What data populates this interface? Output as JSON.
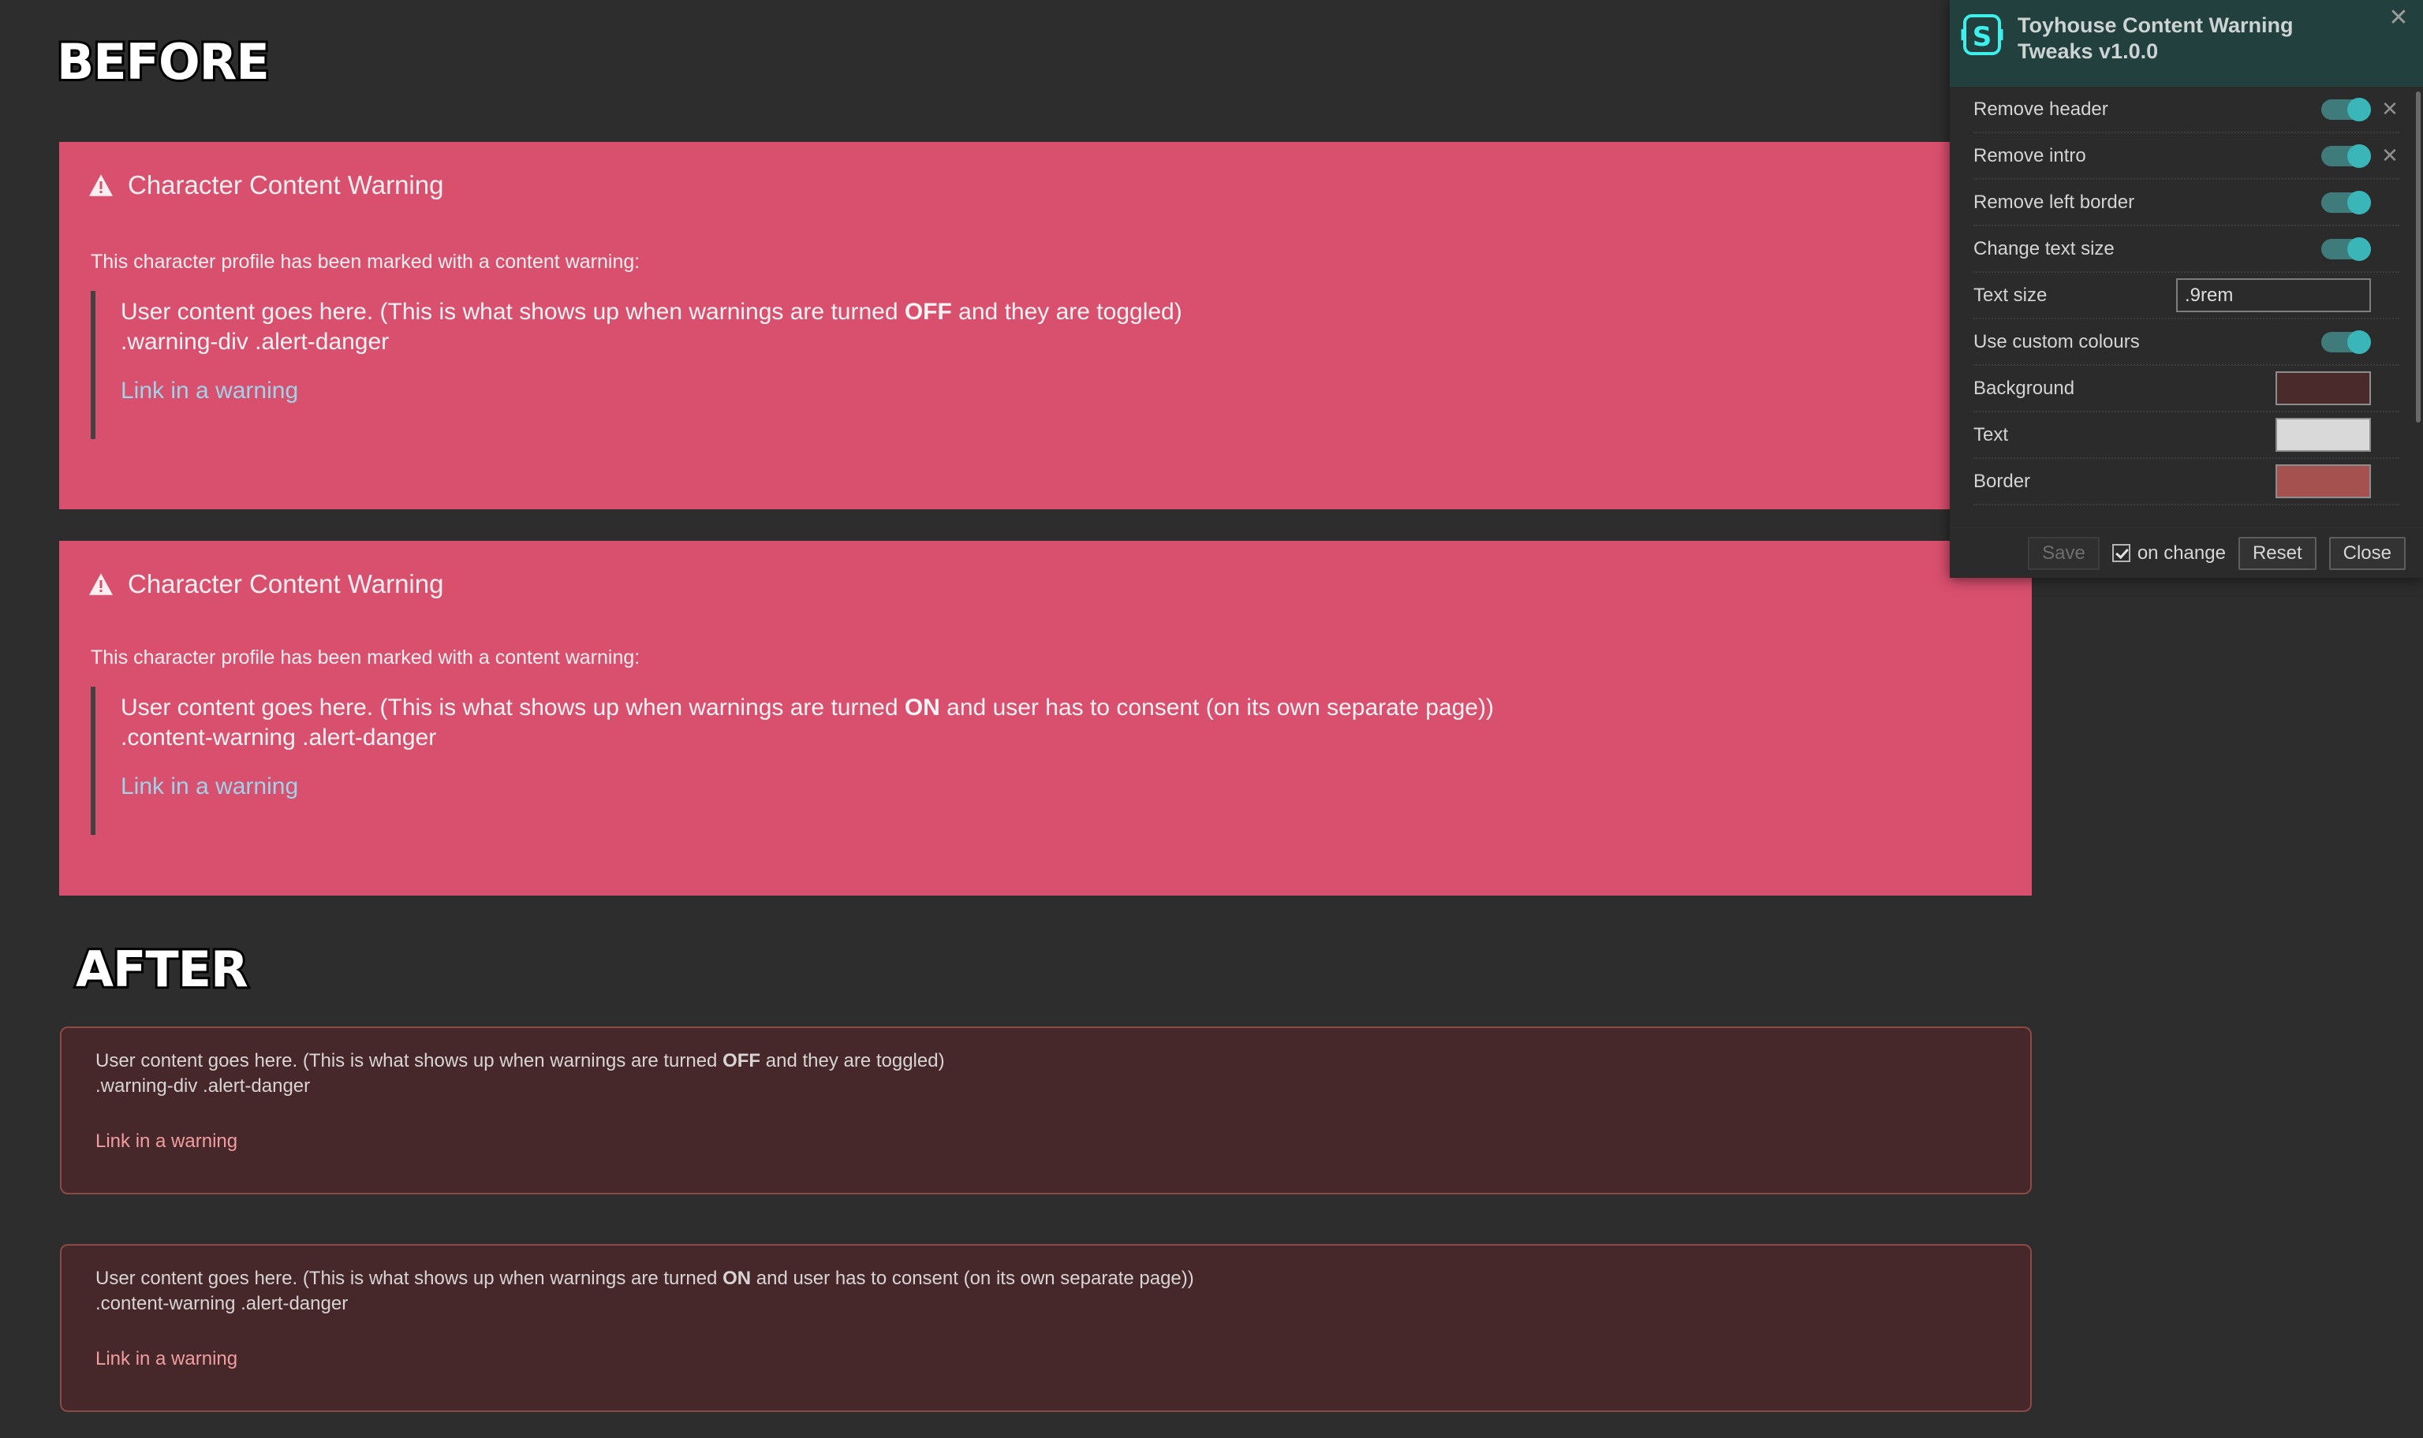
{
  "sections": {
    "before_heading": "BEFORE",
    "after_heading": "AFTER"
  },
  "before_cards": [
    {
      "header": "Character Content Warning",
      "intro": "This character profile has been marked with a content warning:",
      "quote_text_1": "User content goes here. (This is what shows up when warnings are turned ",
      "quote_emphasis": "OFF",
      "quote_text_2": " and they are toggled)",
      "selector": ".warning-div .alert-danger",
      "link": "Link in a warning"
    },
    {
      "header": "Character Content Warning",
      "intro": "This character profile has been marked with a content warning:",
      "quote_text_1": "User content goes here. (This is what shows up when warnings are turned ",
      "quote_emphasis": "ON",
      "quote_text_2": " and user has to consent (on its own separate page))",
      "selector": ".content-warning .alert-danger",
      "link": "Link in a warning"
    }
  ],
  "after_cards": [
    {
      "text_1": "User content goes here. (This is what shows up when warnings are turned ",
      "emphasis": "OFF",
      "text_2": " and they are toggled)",
      "selector": ".warning-div .alert-danger",
      "link": "Link in a warning"
    },
    {
      "text_1": "User content goes here. (This is what shows up when warnings are turned ",
      "emphasis": "ON",
      "text_2": " and user has to consent (on its own separate page))",
      "selector": ".content-warning .alert-danger",
      "link": "Link in a warning"
    }
  ],
  "panel": {
    "title": "Toyhouse Content Warning Tweaks v1.0.0",
    "logo_icon": "stylus-s-logo-icon",
    "close_icon": "✕",
    "row_remove_icon": "✕",
    "options": [
      {
        "label": "Remove header",
        "control": "toggle",
        "state": "on",
        "has_remove": true
      },
      {
        "label": "Remove intro",
        "control": "toggle",
        "state": "on",
        "has_remove": true
      },
      {
        "label": "Remove left border",
        "control": "toggle",
        "state": "on",
        "has_remove": false
      },
      {
        "label": "Change text size",
        "control": "toggle",
        "state": "on",
        "has_remove": false
      },
      {
        "label": "Text size",
        "control": "text",
        "value": ".9rem",
        "has_remove": false
      },
      {
        "label": "Use custom colours",
        "control": "toggle",
        "state": "on",
        "has_remove": false
      },
      {
        "label": "Background",
        "control": "color",
        "value": "#4b2a2b",
        "has_remove": false
      },
      {
        "label": "Text",
        "control": "color",
        "value": "#d9d9d9",
        "has_remove": false
      },
      {
        "label": "Border",
        "control": "color",
        "value": "#a4514f",
        "has_remove": false
      }
    ],
    "footer": {
      "save_label": "Save",
      "on_change_label": "on change",
      "on_change_checked": true,
      "reset_label": "Reset",
      "close_label": "Close"
    }
  },
  "colors": {
    "page_bg": "#2d2d2d",
    "before_card_bg": "#d94f6e",
    "before_link": "#9fd3ea",
    "after_card_bg": "#47282a",
    "after_card_border": "#8b4a45",
    "after_link": "#f09da0",
    "panel_header_bg": "#21403e",
    "panel_bg": "#2b2b2b",
    "toggle_on": "#3ab5b8",
    "logo_accent": "#3ef0ec"
  }
}
